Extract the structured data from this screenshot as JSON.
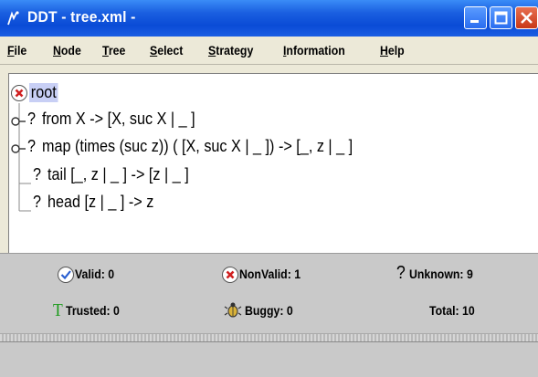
{
  "window": {
    "title": "DDT  - tree.xml -",
    "icon": "ddt-app-icon",
    "buttons": [
      "minimize-icon",
      "maximize-icon",
      "close-icon"
    ]
  },
  "menu": {
    "items": [
      "File",
      "Node",
      "Tree",
      "Select",
      "Strategy",
      "Information",
      "Help"
    ]
  },
  "tree": {
    "root": "root",
    "nodes": [
      {
        "marker": "?",
        "text": "from X  ->   [X, suc X | _ ]",
        "expandable": true
      },
      {
        "marker": "?",
        "text": "map (times (suc z)) ( [X, suc X | _ ])  ->   [_, z | _ ]",
        "expandable": true
      },
      {
        "marker": "?",
        "text": "tail  [_, z | _ ]  ->   [z | _ ]",
        "expandable": false
      },
      {
        "marker": "?",
        "text": "head  [z | _ ]  ->  z",
        "expandable": false
      }
    ]
  },
  "status": {
    "valid": "Valid:  0",
    "nonvalid": "NonValid:  1",
    "unknown": "Unknown:  9",
    "trusted": "Trusted:  0",
    "buggy": "Buggy:  0",
    "total": "Total:  10"
  },
  "colors": {
    "titlebar": "#0a4bd6",
    "root_highlight": "#c8cff5",
    "status_bg": "#c9c9c9",
    "invalid_red": "#d02020",
    "trusted_green": "#1a9a1a"
  }
}
